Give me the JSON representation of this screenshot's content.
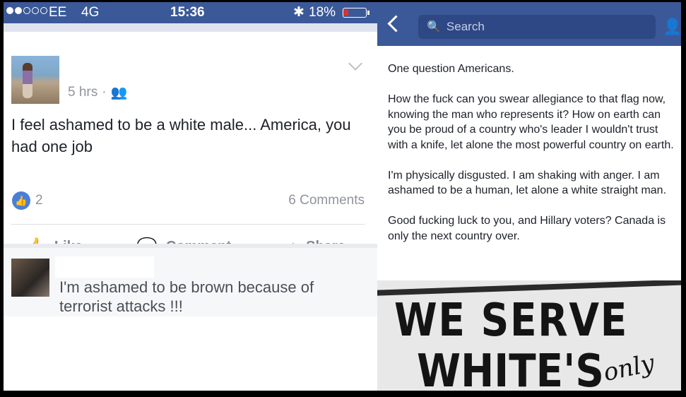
{
  "left_status": {
    "carrier": "EE",
    "network": "4G",
    "time": "15:36",
    "battery": "18%"
  },
  "post": {
    "time": "5 hrs",
    "text": "I feel ashamed to be a white male... America, you had one job",
    "likes": "2",
    "comments": "6 Comments",
    "actions": {
      "like": "Like",
      "comment": "Comment",
      "share": "Share"
    }
  },
  "comment": {
    "text": "I'm ashamed to be brown because of terrorist attacks !!!"
  },
  "right": {
    "search_placeholder": "Search",
    "paragraphs": [
      "One question Americans.",
      "How the fuck can you swear allegiance to that flag now, knowing the man who represents it? How on earth can you be proud of a country who's leader I wouldn't trust with a knife, let alone the most powerful country on earth.",
      "I'm physically disgusted. I am shaking with anger. I am ashamed to be a human, let alone a white straight man.",
      "Good fucking luck to you, and Hillary voters? Canada is only the next country over."
    ],
    "sign": {
      "line1": "WE SERVE",
      "line2": "WHITE'S",
      "line3": "only"
    }
  },
  "colors": {
    "facebook_blue": "#3b5998",
    "like_blue": "#4a7fd8",
    "battery_low": "#e0312a"
  }
}
